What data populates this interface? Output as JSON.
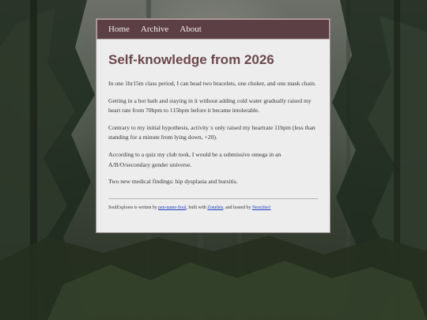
{
  "nav": {
    "items": [
      {
        "label": "Home"
      },
      {
        "label": "Archive"
      },
      {
        "label": "About"
      }
    ]
  },
  "post": {
    "title": "Self-knowledge from 2026",
    "paragraphs": [
      "In one 1hr15m class period, I can bead two bracelets, one choker, and one mask chain.",
      "Getting in a hot bath and staying in it without adding cold water gradually raised my heart rate from 70bpm to 115bpm before it became intolerable.",
      "Contrary to my initial hypothesis, activity x only raised my heartrate 11bpm (less than standing for a minute from lying down, +20).",
      "According to a quiz my club took, I would be a submissive omega in an A/B/O/secondary gender universe.",
      "Two new medical findings: hip dysplasia and bursitis."
    ]
  },
  "footer": {
    "text_1": "SoulExplores is written by ",
    "author_link": "pen-name-Soul",
    "text_2": ", built with ",
    "built_link": "Zonelets",
    "text_3": ", and hosted by ",
    "host_link": "Neocities!"
  },
  "colors": {
    "nav_background": "#5c3f45",
    "title": "#6a474d",
    "card_background": "#ededed",
    "link": "#1d3fbf"
  }
}
